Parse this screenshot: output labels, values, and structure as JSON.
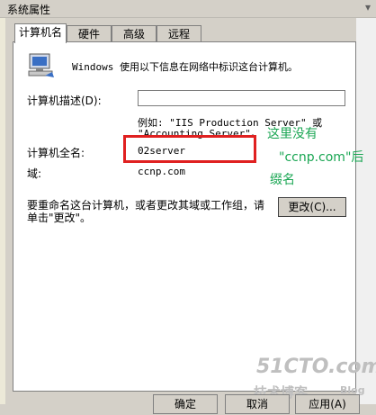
{
  "window": {
    "title": "系统属性"
  },
  "tabs": [
    {
      "label": "计算机名"
    },
    {
      "label": "硬件"
    },
    {
      "label": "高级"
    },
    {
      "label": "远程"
    }
  ],
  "content": {
    "intro": "Windows 使用以下信息在网络中标识这台计算机。",
    "desc_label": "计算机描述(D):",
    "desc_value": "",
    "example_line1": "例如: \"IIS Production Server\" 或",
    "example_line2": "\"Accounting Server\"。",
    "fullname_label": "计算机全名:",
    "fullname_value": "02server",
    "domain_label": "域:",
    "domain_value": "ccnp.com",
    "rename_text_line1": "要重命名这台计算机，或者更改其域或工作组，请",
    "rename_text_line2": "单击\"更改\"。",
    "change_button": "更改(C)..."
  },
  "annotation": {
    "line1": "这里没有",
    "line2": "\"ccnp.com\"后",
    "line3": "缀名"
  },
  "buttons": {
    "ok": "确定",
    "cancel": "取消",
    "apply": "应用(A)"
  },
  "watermark": {
    "site": "51CTO.com",
    "blog": "技术博客",
    "blog_suffix": "Blog"
  },
  "colors": {
    "dialog_bg": "#d4d0c8",
    "panel_bg": "#ffffff",
    "highlight_box": "#e02020",
    "annotation": "#1aa653"
  }
}
